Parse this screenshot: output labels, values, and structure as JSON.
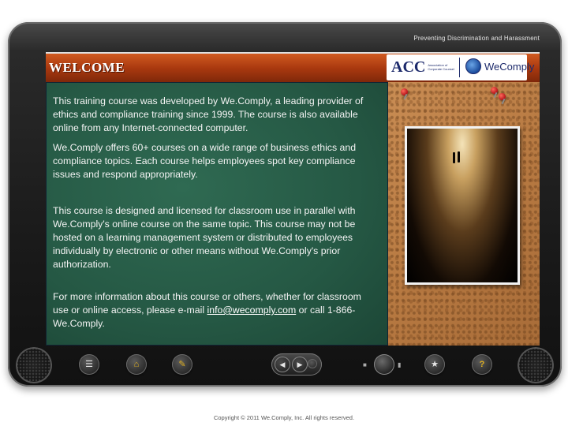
{
  "window": {
    "course_title": "Preventing Discrimination and Harassment"
  },
  "header": {
    "title": "WELCOME"
  },
  "logos": {
    "acc_mark": "ACC",
    "acc_text": "Association of Corporate Counsel",
    "wecomply_text": "WeComply"
  },
  "body": {
    "para1": "This training course was developed by We.Comply, a leading provider of ethics and compliance training since 1999.  The course is also available online from any Internet-connected computer.",
    "para2": "We.Comply offers 60+ courses on a wide range of business ethics and compliance topics.  Each course helps employees spot key compliance issues and respond appropriately.",
    "para3": "This course is designed and licensed for classroom use in parallel with We.Comply's online course on the same topic.  This course may not be hosted on a learning management system or distributed to employees individually by electronic or other means without We.Comply's prior authorization.",
    "para4_prefix": "For more information about this course or others, whether for classroom use or online access, please e-mail",
    "email": "info@wecomply.com",
    "para4_suffix": "or call 1-866-We.Comply."
  },
  "controls": {
    "menu_icon": "menu-icon",
    "home_icon": "home-icon",
    "edit_icon": "pencil-icon",
    "prev_icon": "left-arrow-icon",
    "next_icon": "right-arrow-icon",
    "star_icon": "star-icon",
    "help_icon": "help-icon",
    "help_label": "?"
  },
  "footer": {
    "copyright": "Copyright © 2011 We.Comply, Inc.  All rights reserved."
  },
  "colors": {
    "header_orange": "#b8461a",
    "board_green": "#255844",
    "accent_yellow": "#e0b020"
  }
}
